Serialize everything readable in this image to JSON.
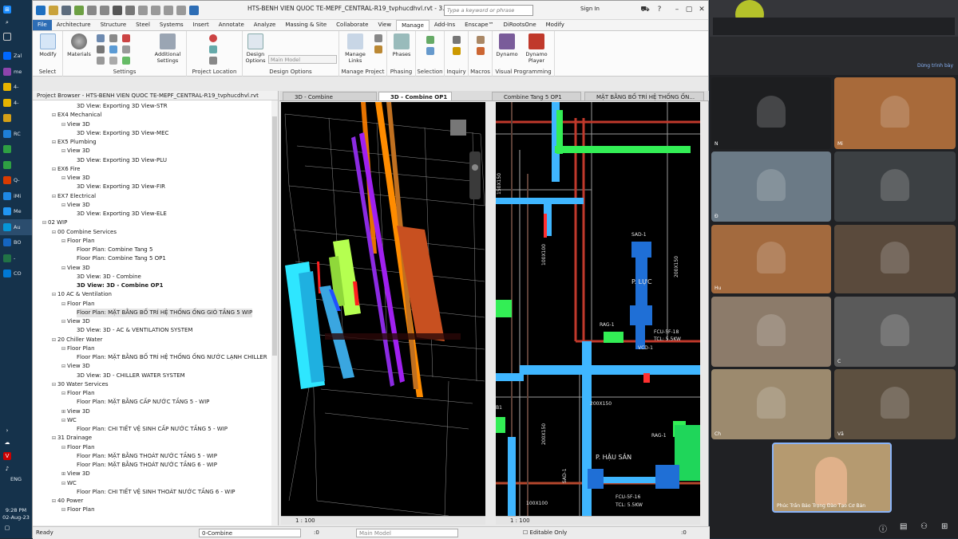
{
  "taskbar": {
    "items": [
      {
        "label": "Zal",
        "color": "#0068ff"
      },
      {
        "label": "me",
        "color": "#8e44ad"
      },
      {
        "label": "4-",
        "color": "#e6b400"
      },
      {
        "label": "4-",
        "color": "#e6b400"
      },
      {
        "label": "",
        "color": "#d4a017"
      },
      {
        "label": "RC",
        "color": "#1e7fd6"
      },
      {
        "label": "",
        "color": "#2ea043"
      },
      {
        "label": "",
        "color": "#2ea043"
      },
      {
        "label": "Q-",
        "color": "#d83b01"
      },
      {
        "label": "iMi",
        "color": "#1e88e5"
      },
      {
        "label": "Me",
        "color": "#2196f3"
      },
      {
        "label": "Au",
        "color": "#0696d7"
      },
      {
        "label": "BO",
        "color": "#1565c0"
      },
      {
        "label": "- ",
        "color": "#217346"
      },
      {
        "label": "CO",
        "color": "#0078d4"
      }
    ],
    "lang": "ENG",
    "time": "9:28 PM",
    "date": "02-Aug-23"
  },
  "revit": {
    "title": "HTS-BENH VIEN QUOC TE-MEPF_CENTRAL-R19_tvphucdhvl.rvt - 3...",
    "search_placeholder": "Type a keyword or phrase",
    "sign_in": "Sign In",
    "tabs": [
      "File",
      "Architecture",
      "Structure",
      "Steel",
      "Systems",
      "Insert",
      "Annotate",
      "Analyze",
      "Massing & Site",
      "Collaborate",
      "View",
      "Manage",
      "Add-Ins",
      "Enscape™",
      "DiRootsOne",
      "Modify"
    ],
    "active_tab": "Manage",
    "panels": {
      "select": "Select",
      "modify": "Modify",
      "materials": "Materials",
      "additional_settings": "Additional Settings",
      "settings": "Settings",
      "project_location": "Project Location",
      "design_options_btn": "Design Options",
      "main_model": "Main Model",
      "design_options": "Design Options",
      "manage_links": "Manage Links",
      "manage_project": "Manage Project",
      "phases": "Phases",
      "phasing": "Phasing",
      "selection": "Selection",
      "inquiry": "Inquiry",
      "macros": "Macros",
      "dynamo": "Dynamo",
      "dynamo_player": "Dynamo Player",
      "visual_programming": "Visual Programming"
    },
    "project_browser": {
      "title": "Project Browser - HTS-BENH VIEN QUOC TE-MEPF_CENTRAL-R19_tvphucdhvl.rvt",
      "rows": [
        {
          "t": "3D View: Exporting 3D View-STR",
          "lvl": 4,
          "tg": ""
        },
        {
          "t": "EX4 Mechanical",
          "lvl": 2,
          "tg": "-"
        },
        {
          "t": "View 3D",
          "lvl": 3,
          "tg": "-"
        },
        {
          "t": "3D View: Exporting 3D View-MEC",
          "lvl": 4,
          "tg": ""
        },
        {
          "t": "EX5 Plumbing",
          "lvl": 2,
          "tg": "-"
        },
        {
          "t": "View 3D",
          "lvl": 3,
          "tg": "-"
        },
        {
          "t": "3D View: Exporting 3D View-PLU",
          "lvl": 4,
          "tg": ""
        },
        {
          "t": "EX6 Fire",
          "lvl": 2,
          "tg": "-"
        },
        {
          "t": "View 3D",
          "lvl": 3,
          "tg": "-"
        },
        {
          "t": "3D View: Exporting 3D View-FIR",
          "lvl": 4,
          "tg": ""
        },
        {
          "t": "EX7 Electrical",
          "lvl": 2,
          "tg": "-"
        },
        {
          "t": "View 3D",
          "lvl": 3,
          "tg": "-"
        },
        {
          "t": "3D View: Exporting 3D View-ELE",
          "lvl": 4,
          "tg": ""
        },
        {
          "t": "02 WIP",
          "lvl": 1,
          "tg": "-"
        },
        {
          "t": "00 Combine Services",
          "lvl": 2,
          "tg": "-"
        },
        {
          "t": "Floor Plan",
          "lvl": 3,
          "tg": "-"
        },
        {
          "t": "Floor Plan: Combine Tang 5",
          "lvl": 4,
          "tg": ""
        },
        {
          "t": "Floor Plan: Combine Tang 5 OP1",
          "lvl": 4,
          "tg": ""
        },
        {
          "t": "View 3D",
          "lvl": 3,
          "tg": "-"
        },
        {
          "t": "3D View: 3D - Combine",
          "lvl": 4,
          "tg": ""
        },
        {
          "t": "3D View: 3D - Combine OP1",
          "lvl": 4,
          "tg": "",
          "bold": true
        },
        {
          "t": "10 AC & Ventilation",
          "lvl": 2,
          "tg": "-"
        },
        {
          "t": "Floor Plan",
          "lvl": 3,
          "tg": "-"
        },
        {
          "t": "Floor Plan: MẶT BẰNG BỐ TRÍ HỆ THỐNG ỐNG GIÓ TẦNG 5 WIP",
          "lvl": 4,
          "tg": "",
          "sel": true
        },
        {
          "t": "View 3D",
          "lvl": 3,
          "tg": "-"
        },
        {
          "t": "3D View: 3D - AC & VENTILATION SYSTEM",
          "lvl": 4,
          "tg": ""
        },
        {
          "t": "20 Chiller Water",
          "lvl": 2,
          "tg": "-"
        },
        {
          "t": "Floor Plan",
          "lvl": 3,
          "tg": "-"
        },
        {
          "t": "Floor Plan: MẶT BẰNG BỐ TRÍ HỆ THỐNG ỐNG NƯỚC LẠNH CHILLER",
          "lvl": 4,
          "tg": ""
        },
        {
          "t": "View 3D",
          "lvl": 3,
          "tg": "-"
        },
        {
          "t": "3D View: 3D - CHILLER WATER SYSTEM",
          "lvl": 4,
          "tg": ""
        },
        {
          "t": "30 Water Services",
          "lvl": 2,
          "tg": "-"
        },
        {
          "t": "Floor Plan",
          "lvl": 3,
          "tg": "-"
        },
        {
          "t": "Floor Plan: MẶT BẰNG CẤP NƯỚC TẦNG 5 - WIP",
          "lvl": 4,
          "tg": ""
        },
        {
          "t": "View 3D",
          "lvl": 3,
          "tg": "+"
        },
        {
          "t": "WC",
          "lvl": 3,
          "tg": "-"
        },
        {
          "t": "Floor Plan: CHI TIẾT VỆ SINH CẤP NƯỚC TẦNG 5 - WIP",
          "lvl": 4,
          "tg": ""
        },
        {
          "t": "31 Drainage",
          "lvl": 2,
          "tg": "-"
        },
        {
          "t": "Floor Plan",
          "lvl": 3,
          "tg": "-"
        },
        {
          "t": "Floor Plan: MẶT BẰNG THOÁT NƯỚC TẦNG 5 - WIP",
          "lvl": 4,
          "tg": ""
        },
        {
          "t": "Floor Plan: MẶT BẰNG THOÁT NƯỚC TẦNG 6 - WIP",
          "lvl": 4,
          "tg": ""
        },
        {
          "t": "View 3D",
          "lvl": 3,
          "tg": "+"
        },
        {
          "t": "WC",
          "lvl": 3,
          "tg": "-"
        },
        {
          "t": "Floor Plan: CHI TIẾT VỆ SINH THOÁT NƯỚC TẦNG 6 - WIP",
          "lvl": 4,
          "tg": ""
        },
        {
          "t": "40 Power",
          "lvl": 2,
          "tg": "-"
        },
        {
          "t": "Floor Plan",
          "lvl": 3,
          "tg": "-"
        }
      ]
    },
    "view_tabs": [
      "3D - Combine",
      "3D - Combine OP1",
      "Combine Tang 5 OP1",
      "MẶT BẰNG BỐ TRÍ HỆ THỐNG ỐN..."
    ],
    "active_view_tab": "3D - Combine OP1",
    "scale_left": "1 : 100",
    "scale_right": "1 : 100",
    "plan_labels": {
      "room1": "P. LỰC",
      "room2": "P. HẬU SẢN",
      "sad1": "SAD-1",
      "rag1": "RAG-1",
      "rag1b": "RAG-1",
      "sad1b": "SAD-1",
      "dim1": "100X100",
      "dim2": "200X150",
      "dim3": "200X150",
      "dim4": "200X150",
      "dim5": "100X100",
      "dim6": "150X150",
      "tag1": "FCU-5F-16",
      "tag2": "TCL: 5.5KW",
      "tag3": "FCU-5F-18",
      "tag4": "TCL: 5.5KW",
      "vcd": "VCD-1",
      "b1": "B1"
    },
    "status": {
      "ready": "Ready",
      "workset": "0-Combine",
      "zero": ":0",
      "main_model": "Main Model",
      "editable_only": "Editable Only",
      "zero2": ":0"
    }
  },
  "meet": {
    "stop_label": "Dừng trình bày",
    "tiles": [
      {
        "name": "N",
        "bg": "#1d1e20"
      },
      {
        "name": "Mi",
        "bg": "#a86a3a"
      },
      {
        "name": "Đ",
        "bg": "#6b7a86"
      },
      {
        "name": "",
        "bg": "#3c4043"
      },
      {
        "name": "",
        "bg": "#5a4a3c"
      },
      {
        "name": "Hu",
        "bg": "#a36a3e"
      },
      {
        "name": "",
        "bg": "#8c7b6a"
      },
      {
        "name": "C",
        "bg": "#5a5a5a"
      },
      {
        "name": "Ch",
        "bg": "#9c8a6e"
      },
      {
        "name": "Vă",
        "bg": "#5d5040"
      },
      {
        "name": "",
        "bg": "#8a8478"
      }
    ],
    "self_name": "Phúc Trần Bảo Trọng Đào Tạo Cơ Bản"
  }
}
